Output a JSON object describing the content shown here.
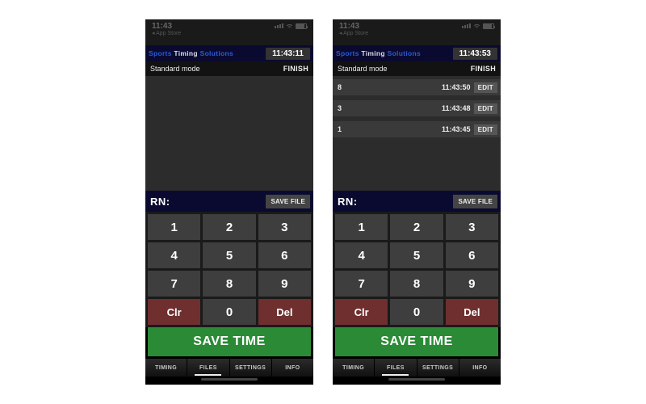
{
  "status": {
    "time": "11:43",
    "back": "◂ App Store"
  },
  "brand": {
    "w1": "Sports",
    "w2": "Timing",
    "w3": "Solutions"
  },
  "mode_label": "Standard mode",
  "finish_label": "FINISH",
  "rn_label": "RN:",
  "save_file_label": "SAVE FILE",
  "save_time_label": "SAVE TIME",
  "keypad": {
    "clr": "Clr",
    "del": "Del",
    "k1": "1",
    "k2": "2",
    "k3": "3",
    "k4": "4",
    "k5": "5",
    "k6": "6",
    "k7": "7",
    "k8": "8",
    "k9": "9",
    "k0": "0"
  },
  "tabs": {
    "timing": "TIMING",
    "files": "FILES",
    "settings": "SETTINGS",
    "info": "INFO"
  },
  "edit_label": "EDIT",
  "screens": [
    {
      "clock": "11:43:11",
      "entries": []
    },
    {
      "clock": "11:43:53",
      "entries": [
        {
          "num": "8",
          "time": "11:43:50"
        },
        {
          "num": "3",
          "time": "11:43:48"
        },
        {
          "num": "1",
          "time": "11:43:45"
        }
      ]
    }
  ]
}
